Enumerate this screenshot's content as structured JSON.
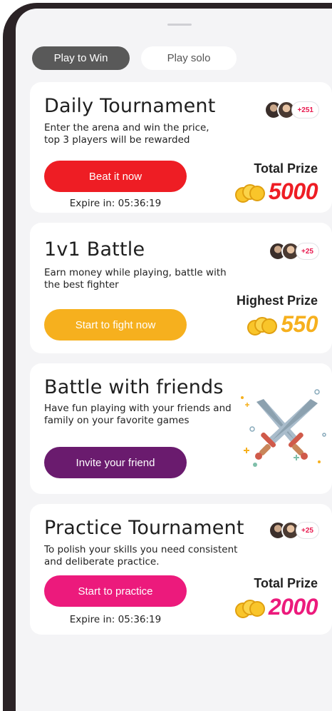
{
  "tabs": {
    "active": "Play to Win",
    "inactive": "Play solo"
  },
  "cards": [
    {
      "title": "Daily Tournament",
      "description_line1": "Enter the arena and win the price,",
      "description_line2": "top 3 players will be rewarded",
      "cta": "Beat it now",
      "expire": "Expire in: 05:36:19",
      "prize_label": "Total Prize",
      "prize_value": "5000",
      "participants_extra": "+251",
      "accent": "#ee1d24"
    },
    {
      "title": "1v1 Battle",
      "description_line1": "Earn money while playing, battle with",
      "description_line2": "the best fighter",
      "cta": "Start to fight now",
      "prize_label": "Highest Prize",
      "prize_value": "550",
      "participants_extra": "+25",
      "accent": "#f6b01e"
    },
    {
      "title": "Battle with friends",
      "description_line1": "Have fun playing with your friends and",
      "description_line2": "family on your favorite games",
      "cta": "Invite your friend",
      "icon": "crossed-swords-icon",
      "accent": "#6a1b6e"
    },
    {
      "title": "Practice Tournament",
      "description_line1": "To polish your skills you need consistent",
      "description_line2": "and deliberate practice.",
      "cta": "Start to practice",
      "expire": "Expire in: 05:36:19",
      "prize_label": "Total Prize",
      "prize_value": "2000",
      "participants_extra": "+25",
      "accent": "#ec1a7c"
    }
  ],
  "colors": {
    "prize_red": "#ee1d24",
    "prize_orange": "#f6b01e",
    "prize_pink": "#ec1a7c",
    "coin": "#f9c52a"
  }
}
